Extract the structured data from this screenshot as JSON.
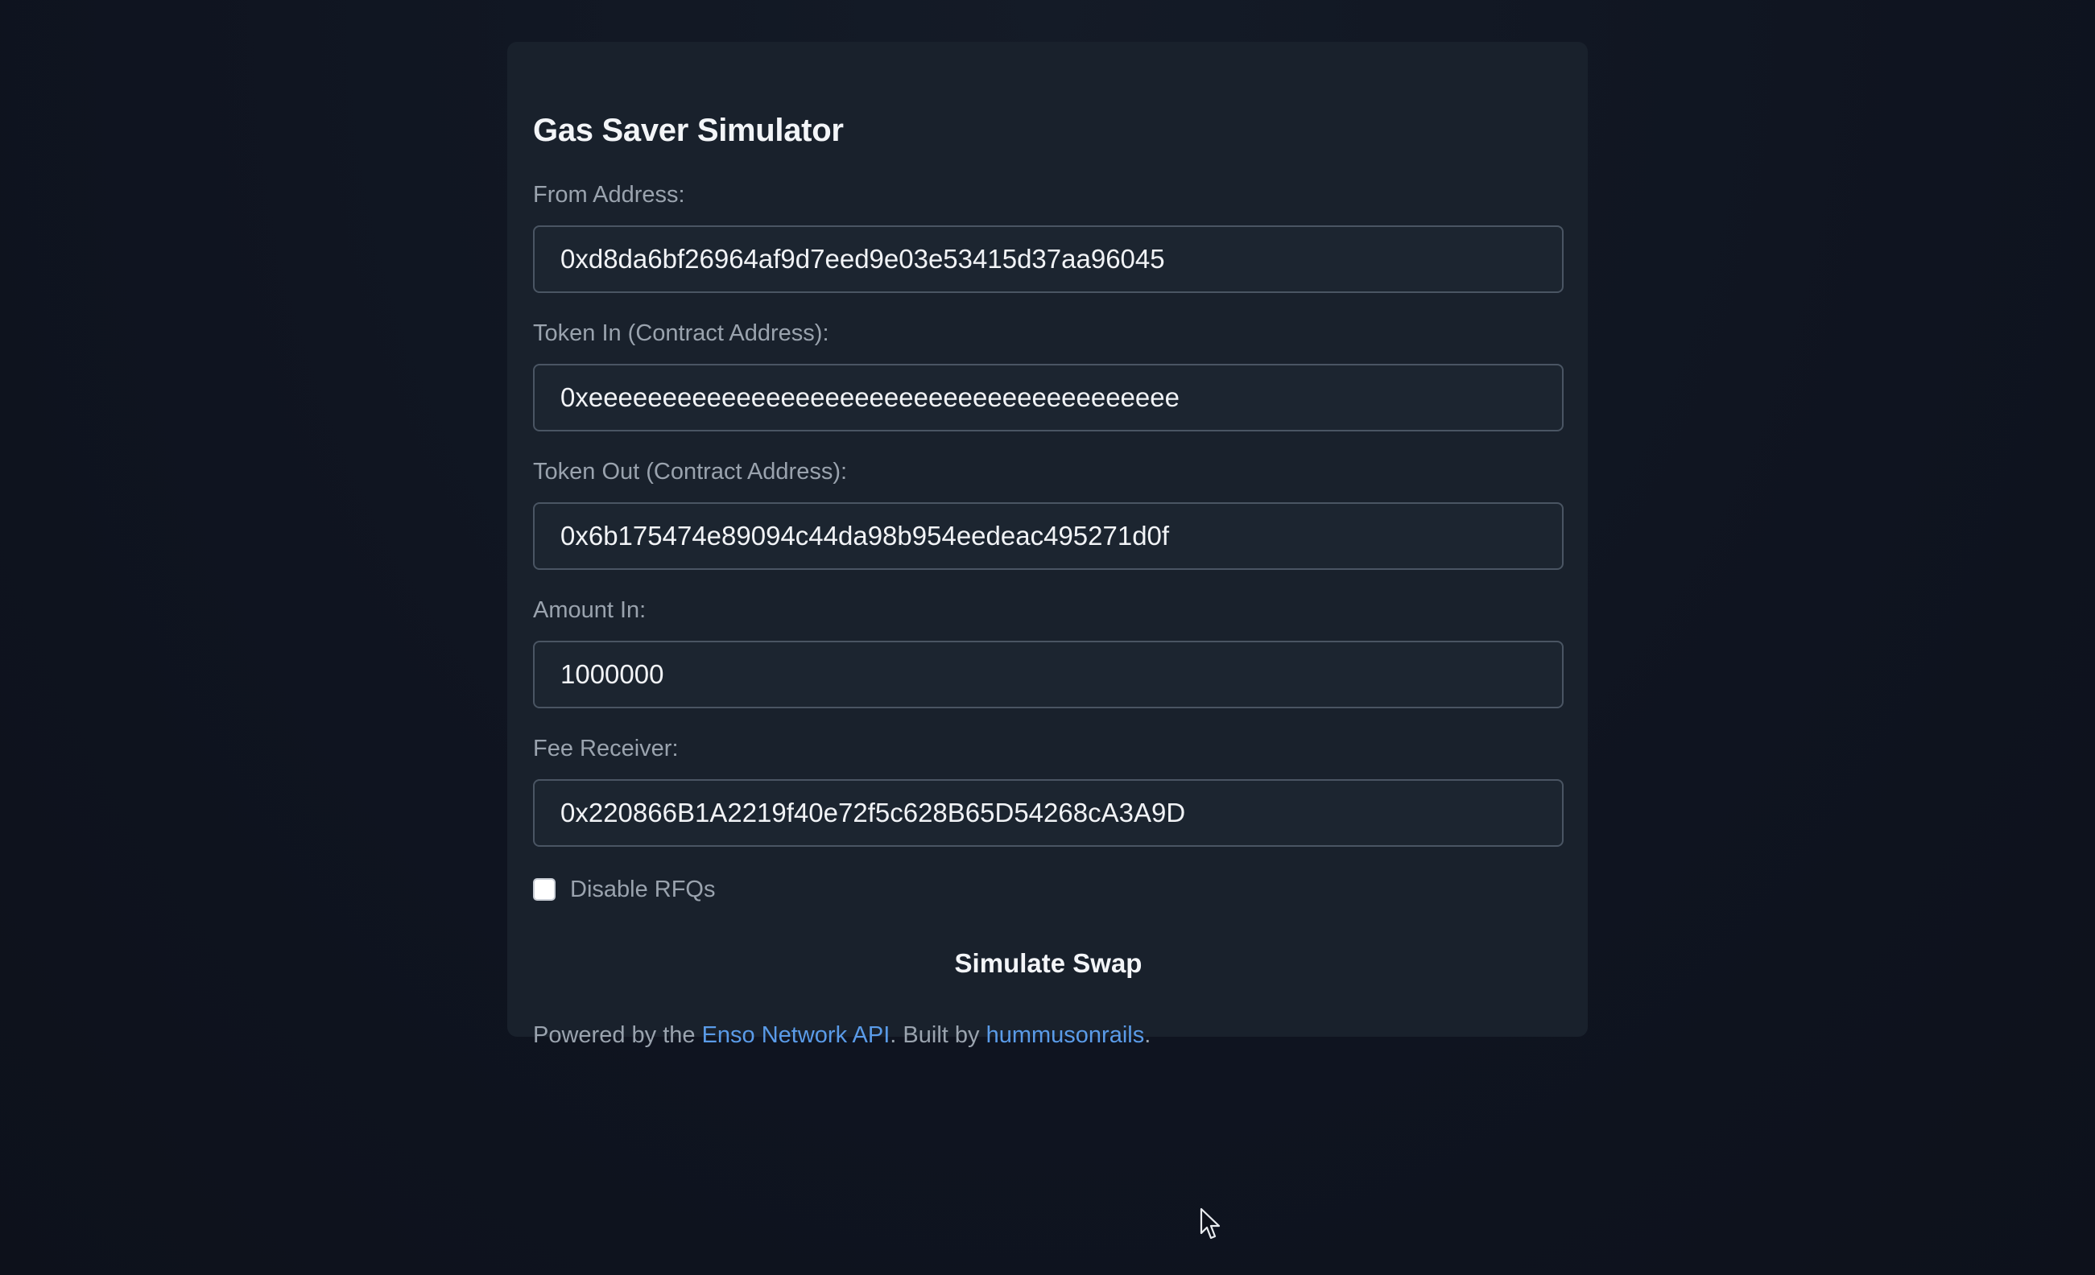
{
  "form": {
    "title": "Gas Saver Simulator",
    "from_address": {
      "label": "From Address:",
      "value": "0xd8da6bf26964af9d7eed9e03e53415d37aa96045"
    },
    "token_in": {
      "label": "Token In (Contract Address):",
      "value": "0xeeeeeeeeeeeeeeeeeeeeeeeeeeeeeeeeeeeeeeee"
    },
    "token_out": {
      "label": "Token Out (Contract Address):",
      "value": "0x6b175474e89094c44da98b954eedeac495271d0f"
    },
    "amount_in": {
      "label": "Amount In:",
      "value": "1000000"
    },
    "fee_receiver": {
      "label": "Fee Receiver:",
      "value": "0x220866B1A2219f40e72f5c628B65D54268cA3A9D"
    },
    "disable_rfqs": {
      "label": "Disable RFQs",
      "checked": false
    },
    "submit_label": "Simulate Swap"
  },
  "footer": {
    "prefix": "Powered by the ",
    "api_link": "Enso Network API",
    "middle": ". Built by ",
    "author_link": "hummusonrails",
    "suffix": "."
  },
  "colors": {
    "background": "#0f1420",
    "card": "#19212c",
    "link": "#5a9be8"
  }
}
